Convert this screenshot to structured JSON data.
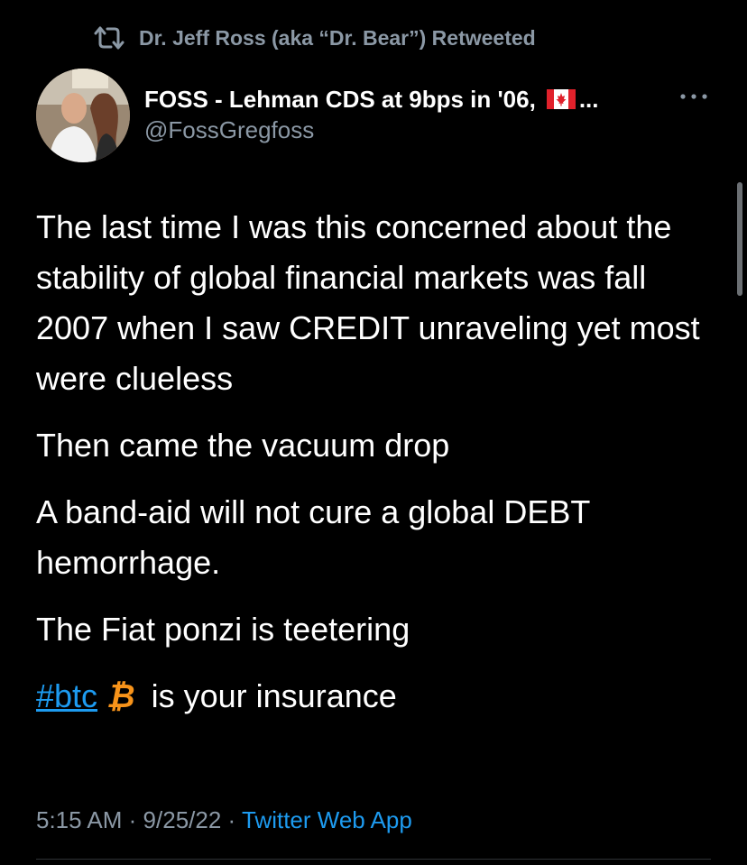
{
  "retweet": {
    "icon": "retweet-icon",
    "text": "Dr. Jeff Ross (aka “Dr. Bear”) Retweeted"
  },
  "author": {
    "display_name": "FOSS - Lehman CDS at 9bps in '06,",
    "flag_icon": "canada-flag-icon",
    "truncation": "...",
    "handle": "@FossGregfoss"
  },
  "more_icon": "more-horizontal-icon",
  "tweet": {
    "paragraphs": [
      "The last time I was this concerned about the stability of global financial markets was fall 2007 when I saw CREDIT unraveling yet most were clueless",
      "Then came the vacuum drop",
      "A band-aid will not cure a global DEBT hemorrhage.",
      "The Fiat ponzi is teetering"
    ],
    "hashtag": "#btc",
    "bitcoin_symbol": "₿",
    "closing_text": "is your insurance"
  },
  "meta": {
    "time": "5:15 AM",
    "separator": "·",
    "date": "9/25/22",
    "source": "Twitter Web App"
  },
  "colors": {
    "background": "#000000",
    "text_primary": "#ffffff",
    "text_secondary": "#8b98a5",
    "link": "#1d9bf0",
    "bitcoin": "#f7931a",
    "divider": "#2f3336"
  }
}
